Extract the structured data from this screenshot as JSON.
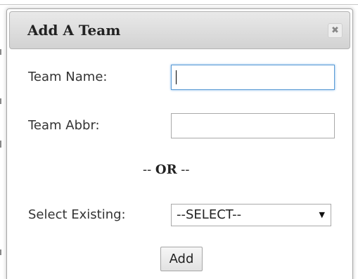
{
  "dialog": {
    "title": "Add A Team",
    "close_glyph": "✖",
    "close_icon": "close-icon"
  },
  "form": {
    "team_name_label": "Team Name:",
    "team_name_value": "",
    "team_abbr_label": "Team Abbr:",
    "team_abbr_value": "",
    "or_dashes_left": "-- ",
    "or_word": "OR",
    "or_dashes_right": " --",
    "select_label": "Select Existing:",
    "select_value": "--SELECT--",
    "select_arrow": "▼",
    "add_label": "Add"
  },
  "colors": {
    "focus_border": "#5b9bd5",
    "titlebar_top": "#e9e9e9",
    "titlebar_bottom": "#d2d2d2"
  }
}
